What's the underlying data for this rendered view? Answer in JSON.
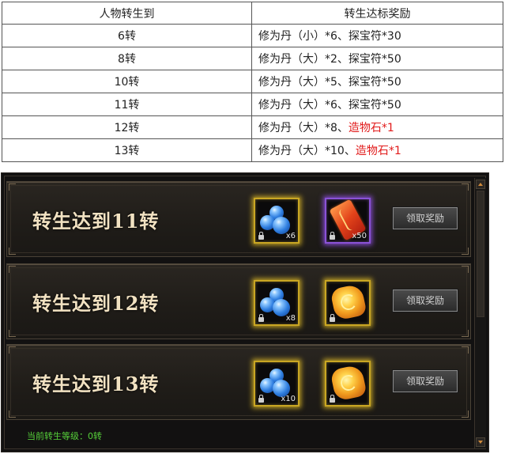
{
  "table": {
    "headers": [
      "人物转生到",
      "转生达标奖励"
    ],
    "rows": [
      {
        "level": "6转",
        "reward_plain": "修为丹（小）*6、探宝符*30",
        "reward_highlight": ""
      },
      {
        "level": "8转",
        "reward_plain": "修为丹（大）*2、探宝符*50",
        "reward_highlight": ""
      },
      {
        "level": "10转",
        "reward_plain": "修为丹（大）*5、探宝符*50",
        "reward_highlight": ""
      },
      {
        "level": "11转",
        "reward_plain": "修为丹（大）*6、探宝符*50",
        "reward_highlight": ""
      },
      {
        "level": "12转",
        "reward_plain": "修为丹（大）*8、",
        "reward_highlight": "造物石*1"
      },
      {
        "level": "13转",
        "reward_plain": "修为丹（大）*10、",
        "reward_highlight": "造物石*1"
      }
    ],
    "highlight_color": "#e11a1a"
  },
  "panel": {
    "rows": [
      {
        "title": "转生达到11转",
        "button": "领取奖励",
        "items": [
          {
            "icon": "blue-pill-orbs-icon",
            "count": "x6",
            "frame": "gold"
          },
          {
            "icon": "talisman-icon",
            "count": "x50",
            "frame": "purple"
          }
        ]
      },
      {
        "title": "转生达到12转",
        "button": "领取奖励",
        "items": [
          {
            "icon": "blue-pill-orbs-icon",
            "count": "x8",
            "frame": "gold"
          },
          {
            "icon": "creation-stone-icon",
            "count": "",
            "frame": "gold"
          }
        ]
      },
      {
        "title": "转生达到13转",
        "button": "领取奖励",
        "items": [
          {
            "icon": "blue-pill-orbs-icon",
            "count": "x10",
            "frame": "gold"
          },
          {
            "icon": "creation-stone-icon",
            "count": "",
            "frame": "gold"
          }
        ]
      }
    ],
    "status_text": "当前转生等级：0转",
    "colors": {
      "title": "#f2e2c2",
      "status": "#56d13a",
      "gold_frame": "#c9a623",
      "purple_frame": "#8a52d6"
    }
  }
}
